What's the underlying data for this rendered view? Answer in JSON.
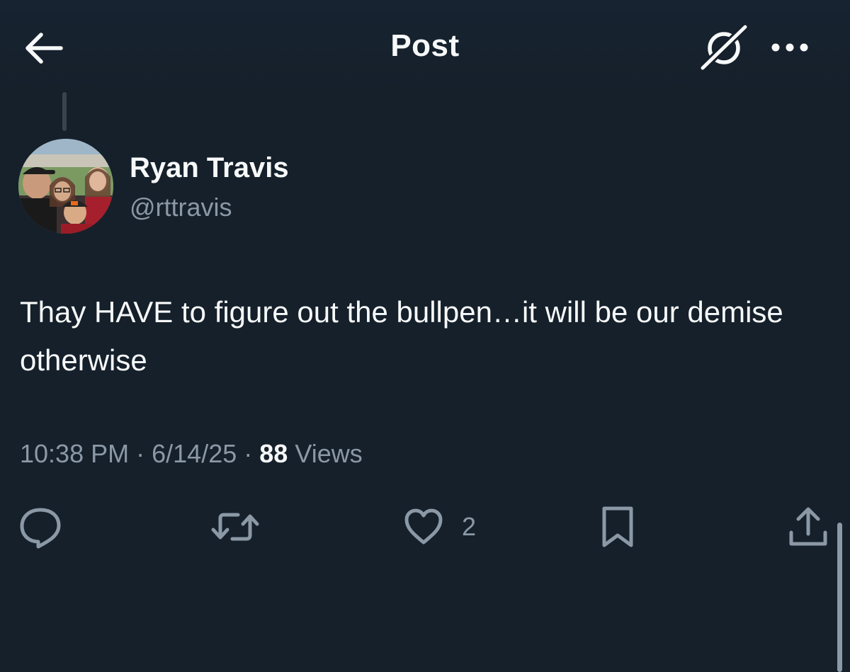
{
  "header": {
    "title": "Post",
    "back_icon": "arrow-left-icon",
    "grok_icon": "grok-icon",
    "more_icon": "more-dots-icon"
  },
  "post": {
    "author": {
      "display_name": "Ryan Travis",
      "handle": "@rttravis",
      "avatar": "family-photo-avatar"
    },
    "text": "Thay HAVE to figure out the bullpen…it will be our demise otherwise",
    "time": "10:38 PM",
    "separator": "·",
    "date": "6/14/25",
    "views_count": "88",
    "views_label": "Views"
  },
  "actions": {
    "reply_icon": "reply-icon",
    "repost_icon": "repost-icon",
    "like_icon": "heart-icon",
    "like_count": "2",
    "bookmark_icon": "bookmark-icon",
    "share_icon": "share-icon"
  },
  "colors": {
    "background": "#15202b",
    "primary_text": "#f7f9f9",
    "secondary_text": "#8b98a5",
    "thread_line": "#38444d"
  }
}
